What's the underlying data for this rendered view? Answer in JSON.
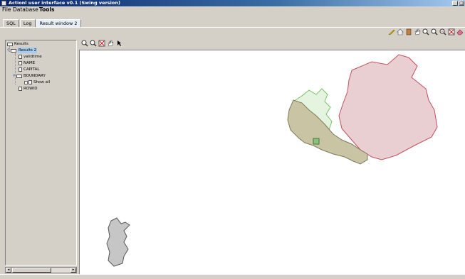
{
  "window": {
    "title": "Actionl user interface v0.1 (Swing version)"
  },
  "menu": {
    "items": [
      "File",
      "Database",
      "Tools"
    ]
  },
  "tabs": [
    "SQL",
    "Log",
    "Result window 2"
  ],
  "toolbar": {
    "icons": [
      "pencil-icon",
      "home-icon",
      "door-icon",
      "hand-icon",
      "zoom-in-icon",
      "zoom-out-icon",
      "zoom-in-2-icon",
      "zoom-extent-icon",
      "eraser-icon"
    ]
  },
  "map_toolbar": {
    "icons": [
      "zoom-in-icon",
      "zoom-out-icon",
      "zoom-extent-icon",
      "pan-hand-icon",
      "pointer-icon"
    ]
  },
  "tree": {
    "root": "Results",
    "child": "Results 2",
    "fields": [
      "validtime",
      "NAME",
      "CAPITAL",
      "BOUNDARY",
      "ROWID"
    ],
    "show_all": "Show all"
  },
  "colors": {
    "accent": "#0a246a",
    "selection": "#a6caf0",
    "pink_region": "#e9cfd1",
    "olive_region": "#c8c4a4",
    "green_region": "#d8f0d0"
  }
}
